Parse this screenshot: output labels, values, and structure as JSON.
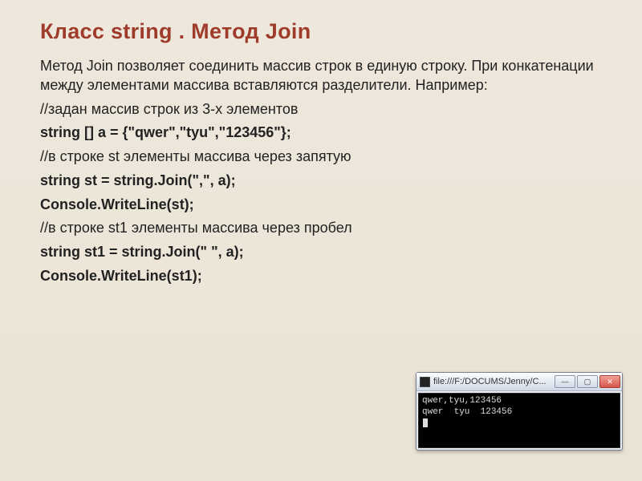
{
  "slide": {
    "title": "Класс string . Метод Join",
    "intro": "Метод Join позволяет соединить массив строк в единую строку. При конкатенации между элементами массива вставляются разделители. Например:",
    "lines": [
      {
        "text": "//задан массив строк из 3-х элементов",
        "strong": false
      },
      {
        "text": "string [] a = {\"qwer\",\"tyu\",\"123456\"};",
        "strong": true
      },
      {
        "text": "//в строке st элементы массива через запятую",
        "strong": false
      },
      {
        "text": "string st = string.Join(\",\", a);",
        "strong": true
      },
      {
        "text": "Console.WriteLine(st);",
        "strong": true
      },
      {
        "text": "//в строке st1 элементы массива через пробел",
        "strong": false
      },
      {
        "text": "string st1 = string.Join(\"  \", a);",
        "strong": true
      },
      {
        "text": "Console.WriteLine(st1);",
        "strong": true
      }
    ]
  },
  "console": {
    "title": "file:///F:/DOCUMS/Jenny/C...",
    "buttons": {
      "min": "—",
      "max": "▢",
      "close": "✕"
    },
    "output": "qwer,tyu,123456\nqwer  tyu  123456"
  }
}
